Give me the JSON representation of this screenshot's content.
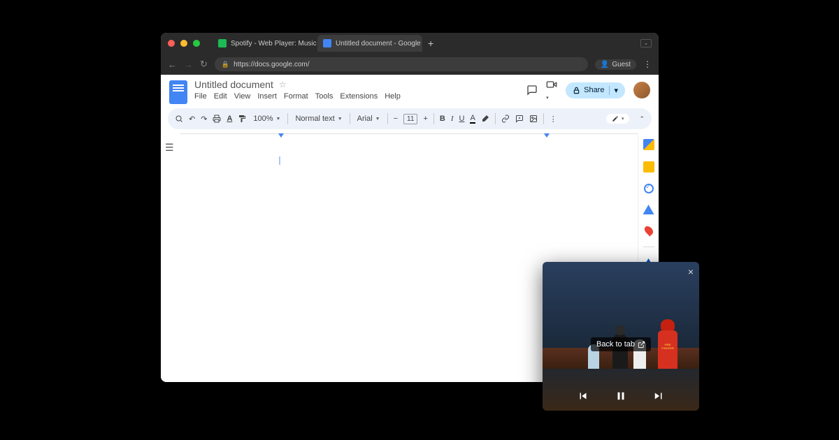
{
  "browser": {
    "tabs": [
      {
        "label": "Spotify - Web Player: Music f...",
        "favicon": "spotify",
        "active": false
      },
      {
        "label": "Untitled document - Google D...",
        "favicon": "docs",
        "active": true
      }
    ],
    "url": "https://docs.google.com/",
    "guest_label": "Guest"
  },
  "docs": {
    "title": "Untitled document",
    "menu": {
      "file": "File",
      "edit": "Edit",
      "view": "View",
      "insert": "Insert",
      "format": "Format",
      "tools": "Tools",
      "extensions": "Extensions",
      "help": "Help"
    },
    "share_label": "Share",
    "toolbar": {
      "zoom": "100%",
      "style": "Normal text",
      "font": "Arial",
      "font_size": "11"
    }
  },
  "pip": {
    "back_to_tab": "Back to tab",
    "firefighter_label": "FIRE FIGHTER"
  }
}
